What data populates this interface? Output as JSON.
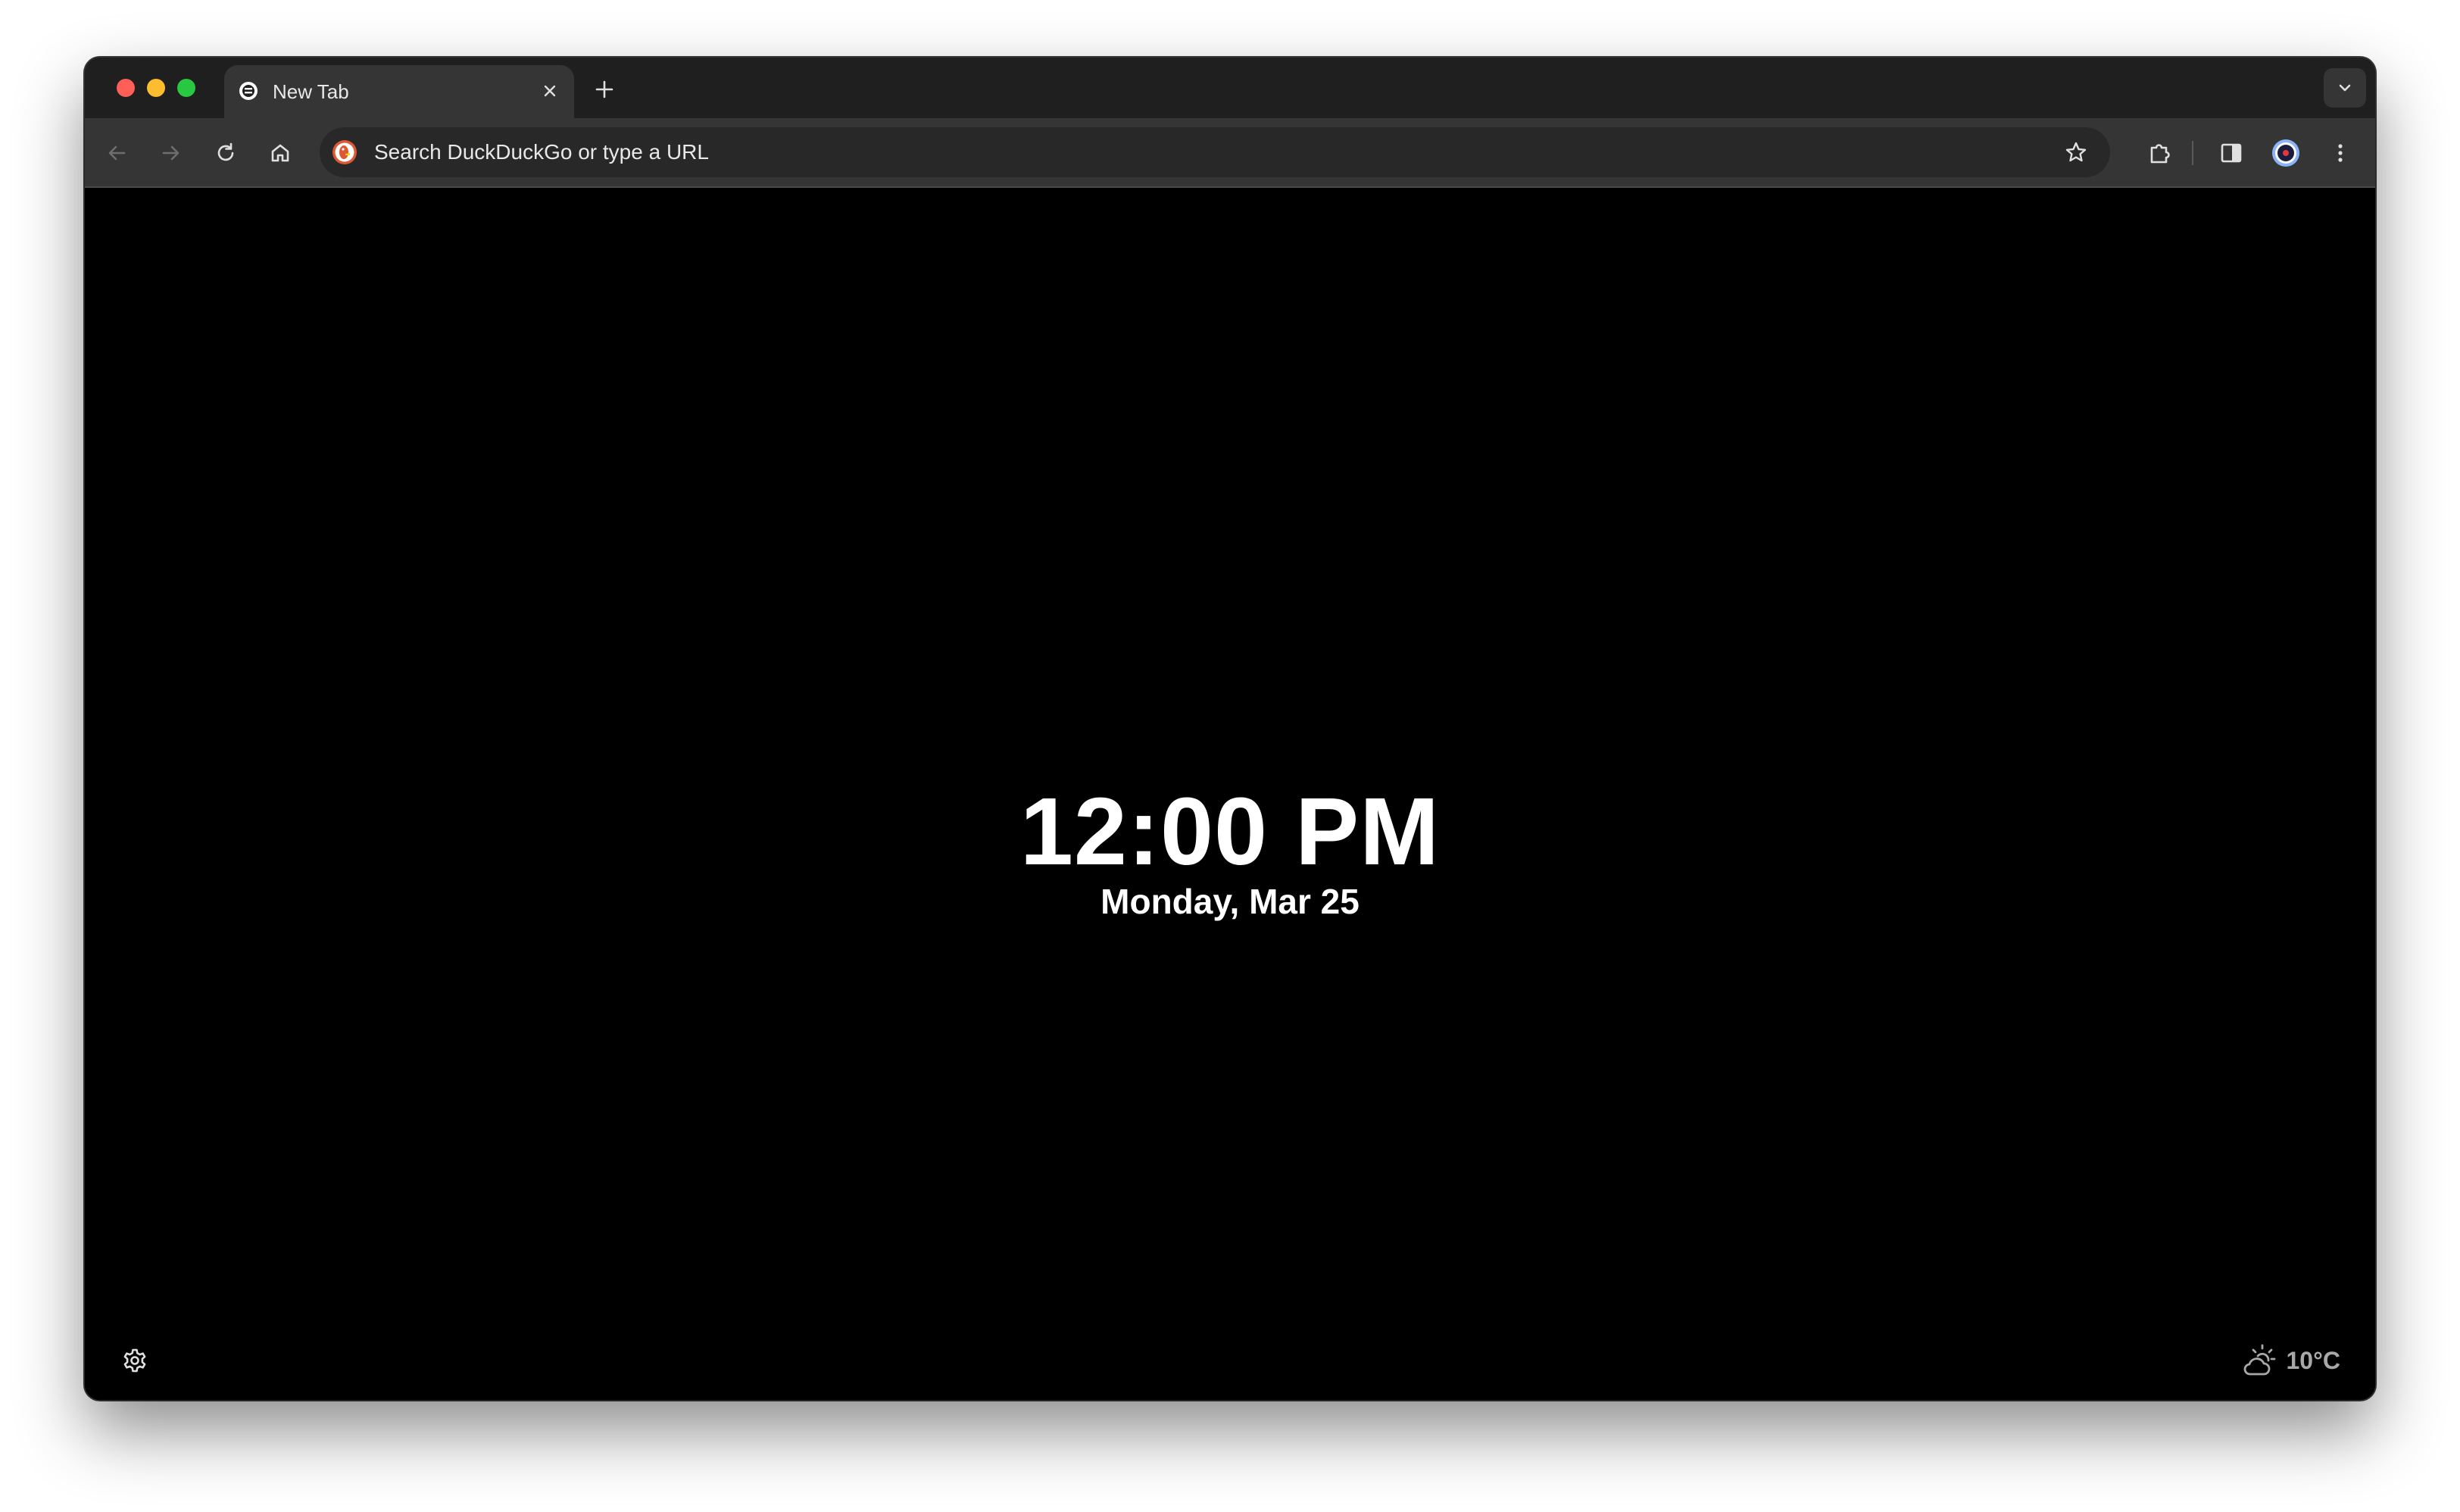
{
  "tabs": [
    {
      "title": "New Tab",
      "active": true
    }
  ],
  "omnibox": {
    "placeholder": "Search DuckDuckGo or type a URL",
    "search_engine_icon": "duckduckgo-icon"
  },
  "toolbar": {
    "icons": [
      "back-icon",
      "forward-icon",
      "reload-icon",
      "home-icon",
      "bookmark-star-icon",
      "extensions-icon",
      "side-panel-icon",
      "profile-avatar",
      "menu-kebab-icon"
    ]
  },
  "newtab": {
    "time": "12:00 PM",
    "date": "Monday, Mar 25",
    "weather": {
      "temperature": "10°C",
      "condition_icon": "partly-cloudy-icon"
    }
  },
  "colors": {
    "window_frame": "#1f1f1f",
    "toolbar": "#353535",
    "omnibox": "#282828",
    "page_background": "#000000",
    "clock_text": "#ffffff",
    "weather_text": "#a8a8a8"
  }
}
